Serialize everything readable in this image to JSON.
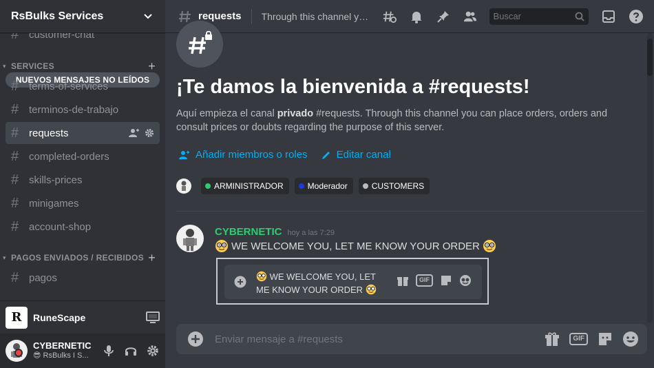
{
  "server": {
    "name": "RsBulks Services"
  },
  "sidebar": {
    "partial_channel": "customer-chat",
    "new_messages_banner": "NUEVOS MENSAJES NO LEÍDOS",
    "categories": [
      {
        "name": "SERVICES",
        "channels": [
          "terms-of-services",
          "terminos-de-trabajo",
          "requests",
          "completed-orders",
          "skills-prices",
          "minigames",
          "account-shop"
        ]
      },
      {
        "name": "PAGOS ENVIADOS / RECIBIDOS",
        "channels": [
          "pagos"
        ]
      }
    ],
    "active_channel": "requests"
  },
  "activity": {
    "name": "RuneScape",
    "logo_letter": "R"
  },
  "user": {
    "name": "CYBERNETIC",
    "status": "RsBulks I S..."
  },
  "topbar": {
    "channel": "requests",
    "topic": "Through this channel you can place orders, orders and consult prices or doubts regarding the purpose of this server.",
    "search_placeholder": "Buscar"
  },
  "welcome": {
    "title": "¡Te damos la bienvenida a #requests!",
    "desc_prefix": "Aquí empieza el canal ",
    "desc_bold": "privado",
    "desc_suffix": " #requests. Through this channel you can place orders, orders and consult prices or doubts regarding the purpose of this server.",
    "add_members": "Añadir miembros o roles",
    "edit_channel": "Editar canal",
    "roles": [
      {
        "name": "ARMINISTRADOR",
        "color": "#2ecc71"
      },
      {
        "name": "Moderador",
        "color": "#1f3bd6"
      },
      {
        "name": "CUSTOMERS",
        "color": "#b9bbbe"
      }
    ]
  },
  "message": {
    "author": "CYBERNETIC",
    "author_color": "#2ecc71",
    "timestamp": "hoy a las 7:29",
    "text": "WE WELCOME YOU, LET ME KNOW YOUR ORDER",
    "embed_line1": "WE WELCOME YOU, LET",
    "embed_line2": "ME KNOW YOUR ORDER"
  },
  "composer": {
    "placeholder": "Enviar mensaje a #requests",
    "gif_label": "GIF"
  },
  "colors": {
    "accent": "#00aff4",
    "sidebar": "#2f3136",
    "main": "#36393f"
  }
}
